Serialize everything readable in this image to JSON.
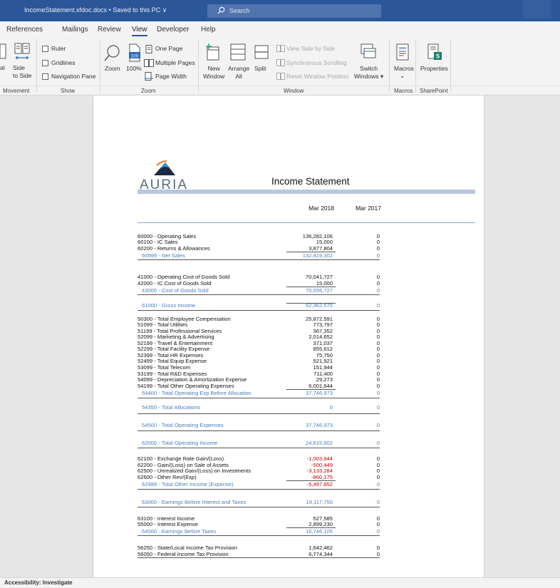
{
  "titlebar": {
    "document_title": "IncomeStatement.xfdoc.docx • Saved to this PC ∨",
    "search_placeholder": "Search"
  },
  "tabs": [
    {
      "label": "References"
    },
    {
      "label": "Mailings"
    },
    {
      "label": "Review"
    },
    {
      "label": "View",
      "active": true
    },
    {
      "label": "Developer"
    },
    {
      "label": "Help"
    }
  ],
  "ribbon": {
    "movement": {
      "partial_label": "al",
      "side_to_side": "Side\nto Side",
      "group": "Movement"
    },
    "show": {
      "ruler": "Ruler",
      "gridlines": "Gridlines",
      "navigation_pane": "Navigation Pane",
      "group": "Show"
    },
    "zoom": {
      "zoom": "Zoom",
      "zoom_100": "100%",
      "one_page": "One Page",
      "multiple_pages": "Multiple Pages",
      "page_width": "Page Width",
      "group": "Zoom"
    },
    "window": {
      "new_window": "New\nWindow",
      "arrange_all": "Arrange\nAll",
      "split": "Split",
      "view_side_by_side": "View Side by Side",
      "synchronous_scrolling": "Synchronous Scrolling",
      "reset_window_position": "Reset Window Position",
      "switch_windows": "Switch\nWindows ▾",
      "group": "Window"
    },
    "macros": {
      "macros": "Macros",
      "macros_arrow": "⌄",
      "group": "Macros"
    },
    "sharepoint": {
      "properties": "Properties",
      "group": "SharePoint"
    }
  },
  "report": {
    "logo_text": "AURIA",
    "title": "Income Statement",
    "col1": "Mar 2018",
    "col2": "Mar 2017",
    "rows": [
      {
        "label": "60000 - Operating Sales",
        "v1": "136,282,106",
        "v2": "0"
      },
      {
        "label": "60100 - IC Sales",
        "v1": "15,000",
        "v2": "0"
      },
      {
        "label": "60200 - Returns & Allowances",
        "v1": "3,877,804",
        "v2": "0"
      },
      {
        "label": "60999 - Net Sales",
        "v1": "132,419,302",
        "v2": "0"
      },
      {
        "label": "41000 - Operating Cost of Goods Sold",
        "v1": "70,041,727",
        "v2": "0"
      },
      {
        "label": "42000 - IC Cost of Goods Sold",
        "v1": "15,000",
        "v2": "0"
      },
      {
        "label": "43000 - Cost of Goods Sold",
        "v1": "70,056,727",
        "v2": "0"
      },
      {
        "label": "61000 - Gross Income",
        "v1": "62,362,575",
        "v2": "0"
      },
      {
        "label": "50300 - Total Employee Compensation",
        "v1": "25,872,591",
        "v2": "0"
      },
      {
        "label": "51099 - Total Utilities",
        "v1": "773,797",
        "v2": "0"
      },
      {
        "label": "51199 - Total Professional Services",
        "v1": "367,352",
        "v2": "0"
      },
      {
        "label": "52099 - Marketing & Advertising",
        "v1": "2,014,652",
        "v2": "0"
      },
      {
        "label": "52199 - Travel & Entertainment",
        "v1": "371,037",
        "v2": "0"
      },
      {
        "label": "52299 - Total Facility Expense",
        "v1": "855,612",
        "v2": "0"
      },
      {
        "label": "52399 - Total HR Expenses",
        "v1": "75,750",
        "v2": "0"
      },
      {
        "label": "52499 - Total Equip Expense",
        "v1": "521,921",
        "v2": "0"
      },
      {
        "label": "53099 - Total Telecom",
        "v1": "151,944",
        "v2": "0"
      },
      {
        "label": "53199 - Total R&D Expenses",
        "v1": "711,400",
        "v2": "0"
      },
      {
        "label": "54099 - Depreciation & Amortization Expense",
        "v1": "29,273",
        "v2": "0"
      },
      {
        "label": "54199 - Total Other Operating Expenses",
        "v1": "6,001,644",
        "v2": "0"
      },
      {
        "label": "54400 - Total Operating Exp Before Allocation",
        "v1": "37,746,973",
        "v2": "0"
      },
      {
        "label": "54350 - Total Allocations",
        "v1": "0",
        "v2": "0"
      },
      {
        "label": "54500 - Total Operating Expenses",
        "v1": "37,746,973",
        "v2": "0"
      },
      {
        "label": "62000 - Total Operating Income",
        "v1": "24,615,602",
        "v2": "0"
      },
      {
        "label": "62100 - Exchange Rate Gain/(Loss)",
        "v1": "-1,003,944",
        "v2": "0"
      },
      {
        "label": "62200 - Gain/(Loss) on Sale of Assets",
        "v1": "-500,449",
        "v2": "0"
      },
      {
        "label": "62500 - Unrealized Gain/(Loss) on Investments",
        "v1": "-3,133,284",
        "v2": "0"
      },
      {
        "label": "62600 - Other Rev/(Exp)",
        "v1": "-860,175",
        "v2": "0"
      },
      {
        "label": "62999 - Total Other Income (Expense)",
        "v1": "-5,497,852",
        "v2": "0"
      },
      {
        "label": "63000 - Earnings Before Interest and Taxes",
        "v1": "19,117,750",
        "v2": "0"
      },
      {
        "label": "63100 - Interest Income",
        "v1": "527,585",
        "v2": "0"
      },
      {
        "label": "55000 - Interest Expense",
        "v1": "2,899,230",
        "v2": "0"
      },
      {
        "label": "64000 - Earnings Before Taxes",
        "v1": "16,746,105",
        "v2": "0"
      },
      {
        "label": "56250 - State/Local Income Tax Provision",
        "v1": "1,642,462",
        "v2": "0"
      },
      {
        "label": "56050 - Federal Income Tax Provision",
        "v1": "6,774,344",
        "v2": "0"
      }
    ]
  },
  "statusbar": {
    "accessibility": "Accessibility: Investigate"
  },
  "colors": {
    "titlebar": "#2b579a",
    "subtotal": "#4a7fc1",
    "negative": "#c00000"
  }
}
